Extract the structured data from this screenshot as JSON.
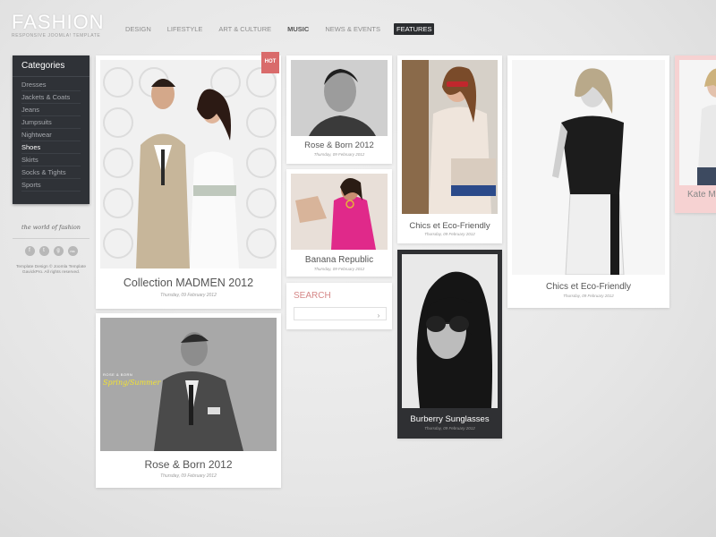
{
  "header": {
    "logo_title": "FASHION",
    "logo_subtitle": "RESPONSIVE JOOMLA! TEMPLATE",
    "nav": [
      {
        "label": "DESIGN"
      },
      {
        "label": "LIFESTYLE"
      },
      {
        "label": "ART & CULTURE"
      },
      {
        "label": "MUSIC"
      },
      {
        "label": "NEWS & EVENTS"
      },
      {
        "label": "FEATURES"
      }
    ]
  },
  "sidebar": {
    "categories_title": "Categories",
    "items": [
      "Dresses",
      "Jackets & Coats",
      "Jeans",
      "Jumpsuits",
      "Nightwear",
      "Shoes",
      "Skirts",
      "Socks & Tights",
      "Sports"
    ],
    "active_item": "Shoes",
    "script_text": "the world of fashion",
    "social": [
      "f",
      "t",
      "g",
      "rss"
    ],
    "copyright": "Template Design © Joomla Template GavickPro. All rights reserved."
  },
  "cards": [
    {
      "title": "Collection MADMEN 2012",
      "date": "Thursday, 09 February 2012",
      "badge": "HOT"
    },
    {
      "title": "Rose & Born  2012",
      "date": "Thursday, 09 February 2012",
      "overlay_brand": "ROSE & BORN",
      "overlay_text": "Spring/Summer"
    },
    {
      "title": "Rose & Born  2012",
      "date": "Thursday, 09 February 2012"
    },
    {
      "title": "Banana Republic",
      "date": "Thursday, 09 February 2012"
    },
    {
      "title": "Chics et Eco-Friendly",
      "date": "Thursday, 09 February 2012"
    },
    {
      "title": "Burberry Sunglasses",
      "date": "Thursday, 09 February 2012"
    },
    {
      "title": "Chics et Eco-Friendly",
      "date": "Thursday, 09 February 2012"
    },
    {
      "title": "Kate M"
    }
  ],
  "search": {
    "title": "SEARCH",
    "value": "",
    "button": "›"
  },
  "colors": {
    "accent": "#d96b6b",
    "sidebar_bg": "#2f3237",
    "search_title": "#d58787"
  }
}
